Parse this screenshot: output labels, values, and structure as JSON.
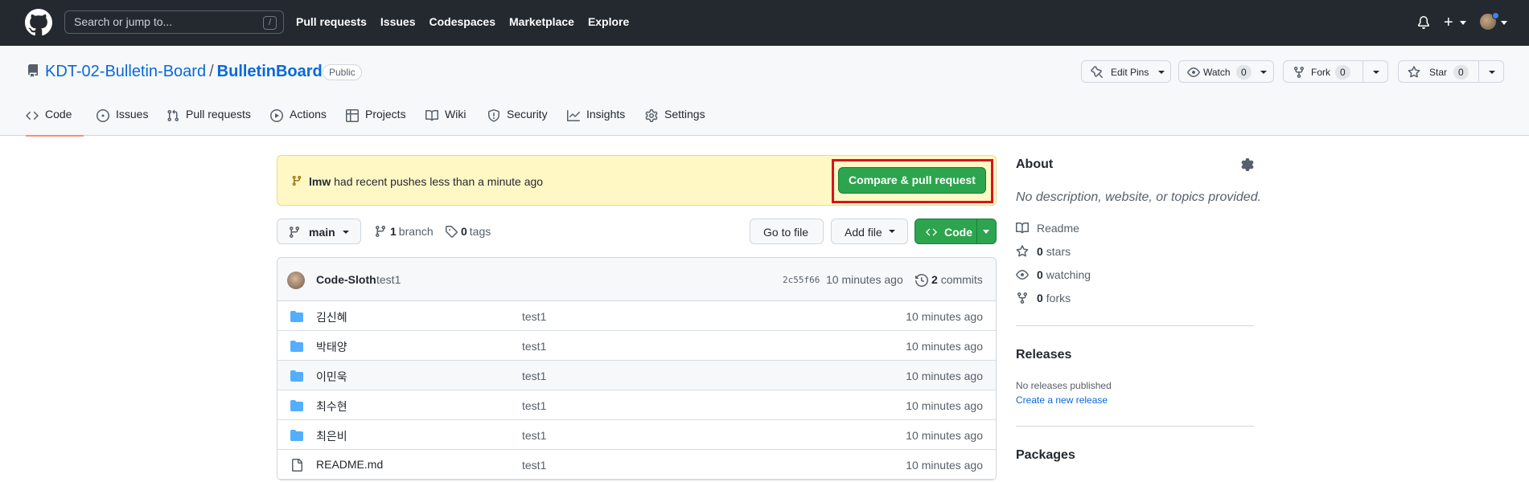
{
  "header": {
    "search_placeholder": "Search or jump to...",
    "search_shortcut": "/",
    "nav": [
      "Pull requests",
      "Issues",
      "Codespaces",
      "Marketplace",
      "Explore"
    ],
    "plus": "+"
  },
  "repo": {
    "owner": "KDT-02-Bulletin-Board",
    "separator": "/",
    "name": "BulletinBoard",
    "visibility": "Public",
    "actions": {
      "edit_pins": "Edit Pins",
      "watch": "Watch",
      "watch_count": "0",
      "fork": "Fork",
      "fork_count": "0",
      "star": "Star",
      "star_count": "0"
    },
    "tabs": [
      "Code",
      "Issues",
      "Pull requests",
      "Actions",
      "Projects",
      "Wiki",
      "Security",
      "Insights",
      "Settings"
    ],
    "active_tab": "Code"
  },
  "banner": {
    "user": "lmw",
    "text": " had recent pushes less than a minute ago",
    "button": "Compare & pull request"
  },
  "toolbar": {
    "branch": "main",
    "branch_count": "1",
    "branch_label": "branch",
    "tag_count": "0",
    "tag_label": "tags",
    "go_to_file": "Go to file",
    "add_file": "Add file",
    "code": "Code"
  },
  "latest_commit": {
    "author": "Code-Sloth",
    "message": "test1",
    "sha": "2c55f66",
    "time": "10 minutes ago",
    "commit_count": "2",
    "commit_label": "commits"
  },
  "files": [
    {
      "name": "김신혜",
      "type": "dir",
      "message": "test1",
      "age": "10 minutes ago"
    },
    {
      "name": "박태양",
      "type": "dir",
      "message": "test1",
      "age": "10 minutes ago"
    },
    {
      "name": "이민욱",
      "type": "dir",
      "message": "test1",
      "age": "10 minutes ago"
    },
    {
      "name": "최수현",
      "type": "dir",
      "message": "test1",
      "age": "10 minutes ago"
    },
    {
      "name": "최은비",
      "type": "dir",
      "message": "test1",
      "age": "10 minutes ago"
    },
    {
      "name": "README.md",
      "type": "file",
      "message": "test1",
      "age": "10 minutes ago"
    }
  ],
  "about": {
    "title": "About",
    "description": "No description, website, or topics provided.",
    "readme": "Readme",
    "stars_count": "0",
    "stars_label": "stars",
    "watching_count": "0",
    "watching_label": "watching",
    "forks_count": "0",
    "forks_label": "forks"
  },
  "releases": {
    "title": "Releases",
    "none": "No releases published",
    "create": "Create a new release"
  },
  "packages": {
    "title": "Packages"
  },
  "colors": {
    "header_bg": "#24292f",
    "link": "#0969da",
    "green": "#2da44e",
    "banner_bg": "#fff8c5",
    "highlight_frame": "#d8141b",
    "folder": "#54aeff"
  }
}
